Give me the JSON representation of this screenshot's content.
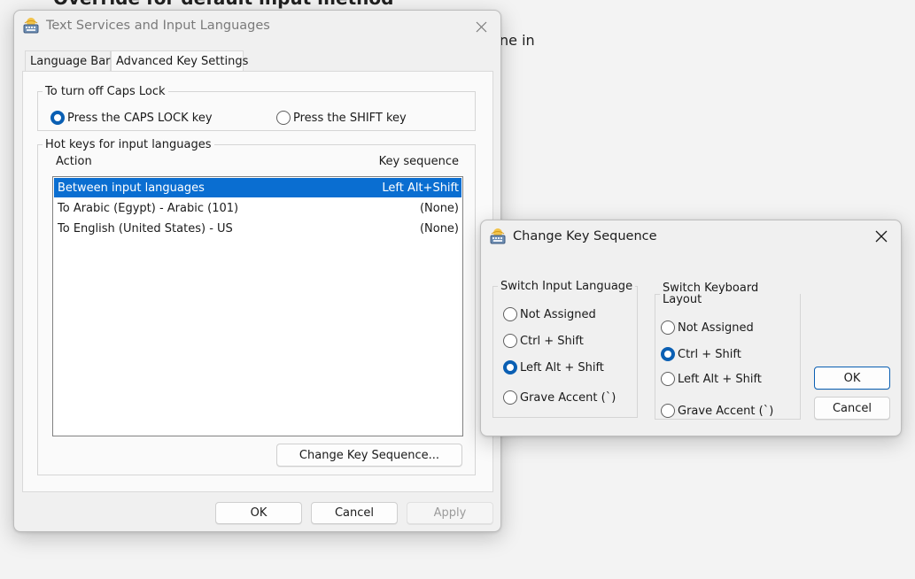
{
  "background": {
    "heading": "Override for default input method",
    "text": "ne in"
  },
  "main_dialog": {
    "title": "Text Services and Input Languages",
    "tabs": [
      {
        "label": "Language Bar",
        "active": false
      },
      {
        "label": "Advanced Key Settings",
        "active": true
      }
    ],
    "caps_lock": {
      "legend": "To turn off Caps Lock",
      "options": [
        {
          "label": "Press the CAPS LOCK key",
          "selected": true
        },
        {
          "label": "Press the SHIFT key",
          "selected": false
        }
      ]
    },
    "hotkeys": {
      "legend": "Hot keys for input languages",
      "columns": {
        "action": "Action",
        "sequence": "Key sequence"
      },
      "rows": [
        {
          "action": "Between input languages",
          "sequence": "Left Alt+Shift",
          "selected": true
        },
        {
          "action": "To Arabic (Egypt) - Arabic (101)",
          "sequence": "(None)",
          "selected": false
        },
        {
          "action": "To English (United States) - US",
          "sequence": "(None)",
          "selected": false
        }
      ],
      "change_button": "Change Key Sequence..."
    },
    "buttons": {
      "ok": "OK",
      "cancel": "Cancel",
      "apply": "Apply"
    }
  },
  "change_dialog": {
    "title": "Change Key Sequence",
    "input_language": {
      "legend": "Switch Input Language",
      "options": [
        {
          "label": "Not Assigned",
          "selected": false
        },
        {
          "label": "Ctrl + Shift",
          "selected": false
        },
        {
          "label": "Left Alt + Shift",
          "selected": true
        },
        {
          "label": "Grave Accent (`)",
          "selected": false
        }
      ]
    },
    "keyboard_layout": {
      "legend": "Switch Keyboard Layout",
      "options": [
        {
          "label": "Not Assigned",
          "selected": false
        },
        {
          "label": "Ctrl + Shift",
          "selected": true
        },
        {
          "label": "Left Alt + Shift",
          "selected": false
        },
        {
          "label": "Grave Accent (`)",
          "selected": false
        }
      ]
    },
    "buttons": {
      "ok": "OK",
      "cancel": "Cancel"
    }
  },
  "colors": {
    "accent": "#0a6ed1",
    "radio_on": "#0a5fb3"
  },
  "icons": {
    "app": "keyboard-icon",
    "close": "close-icon"
  }
}
